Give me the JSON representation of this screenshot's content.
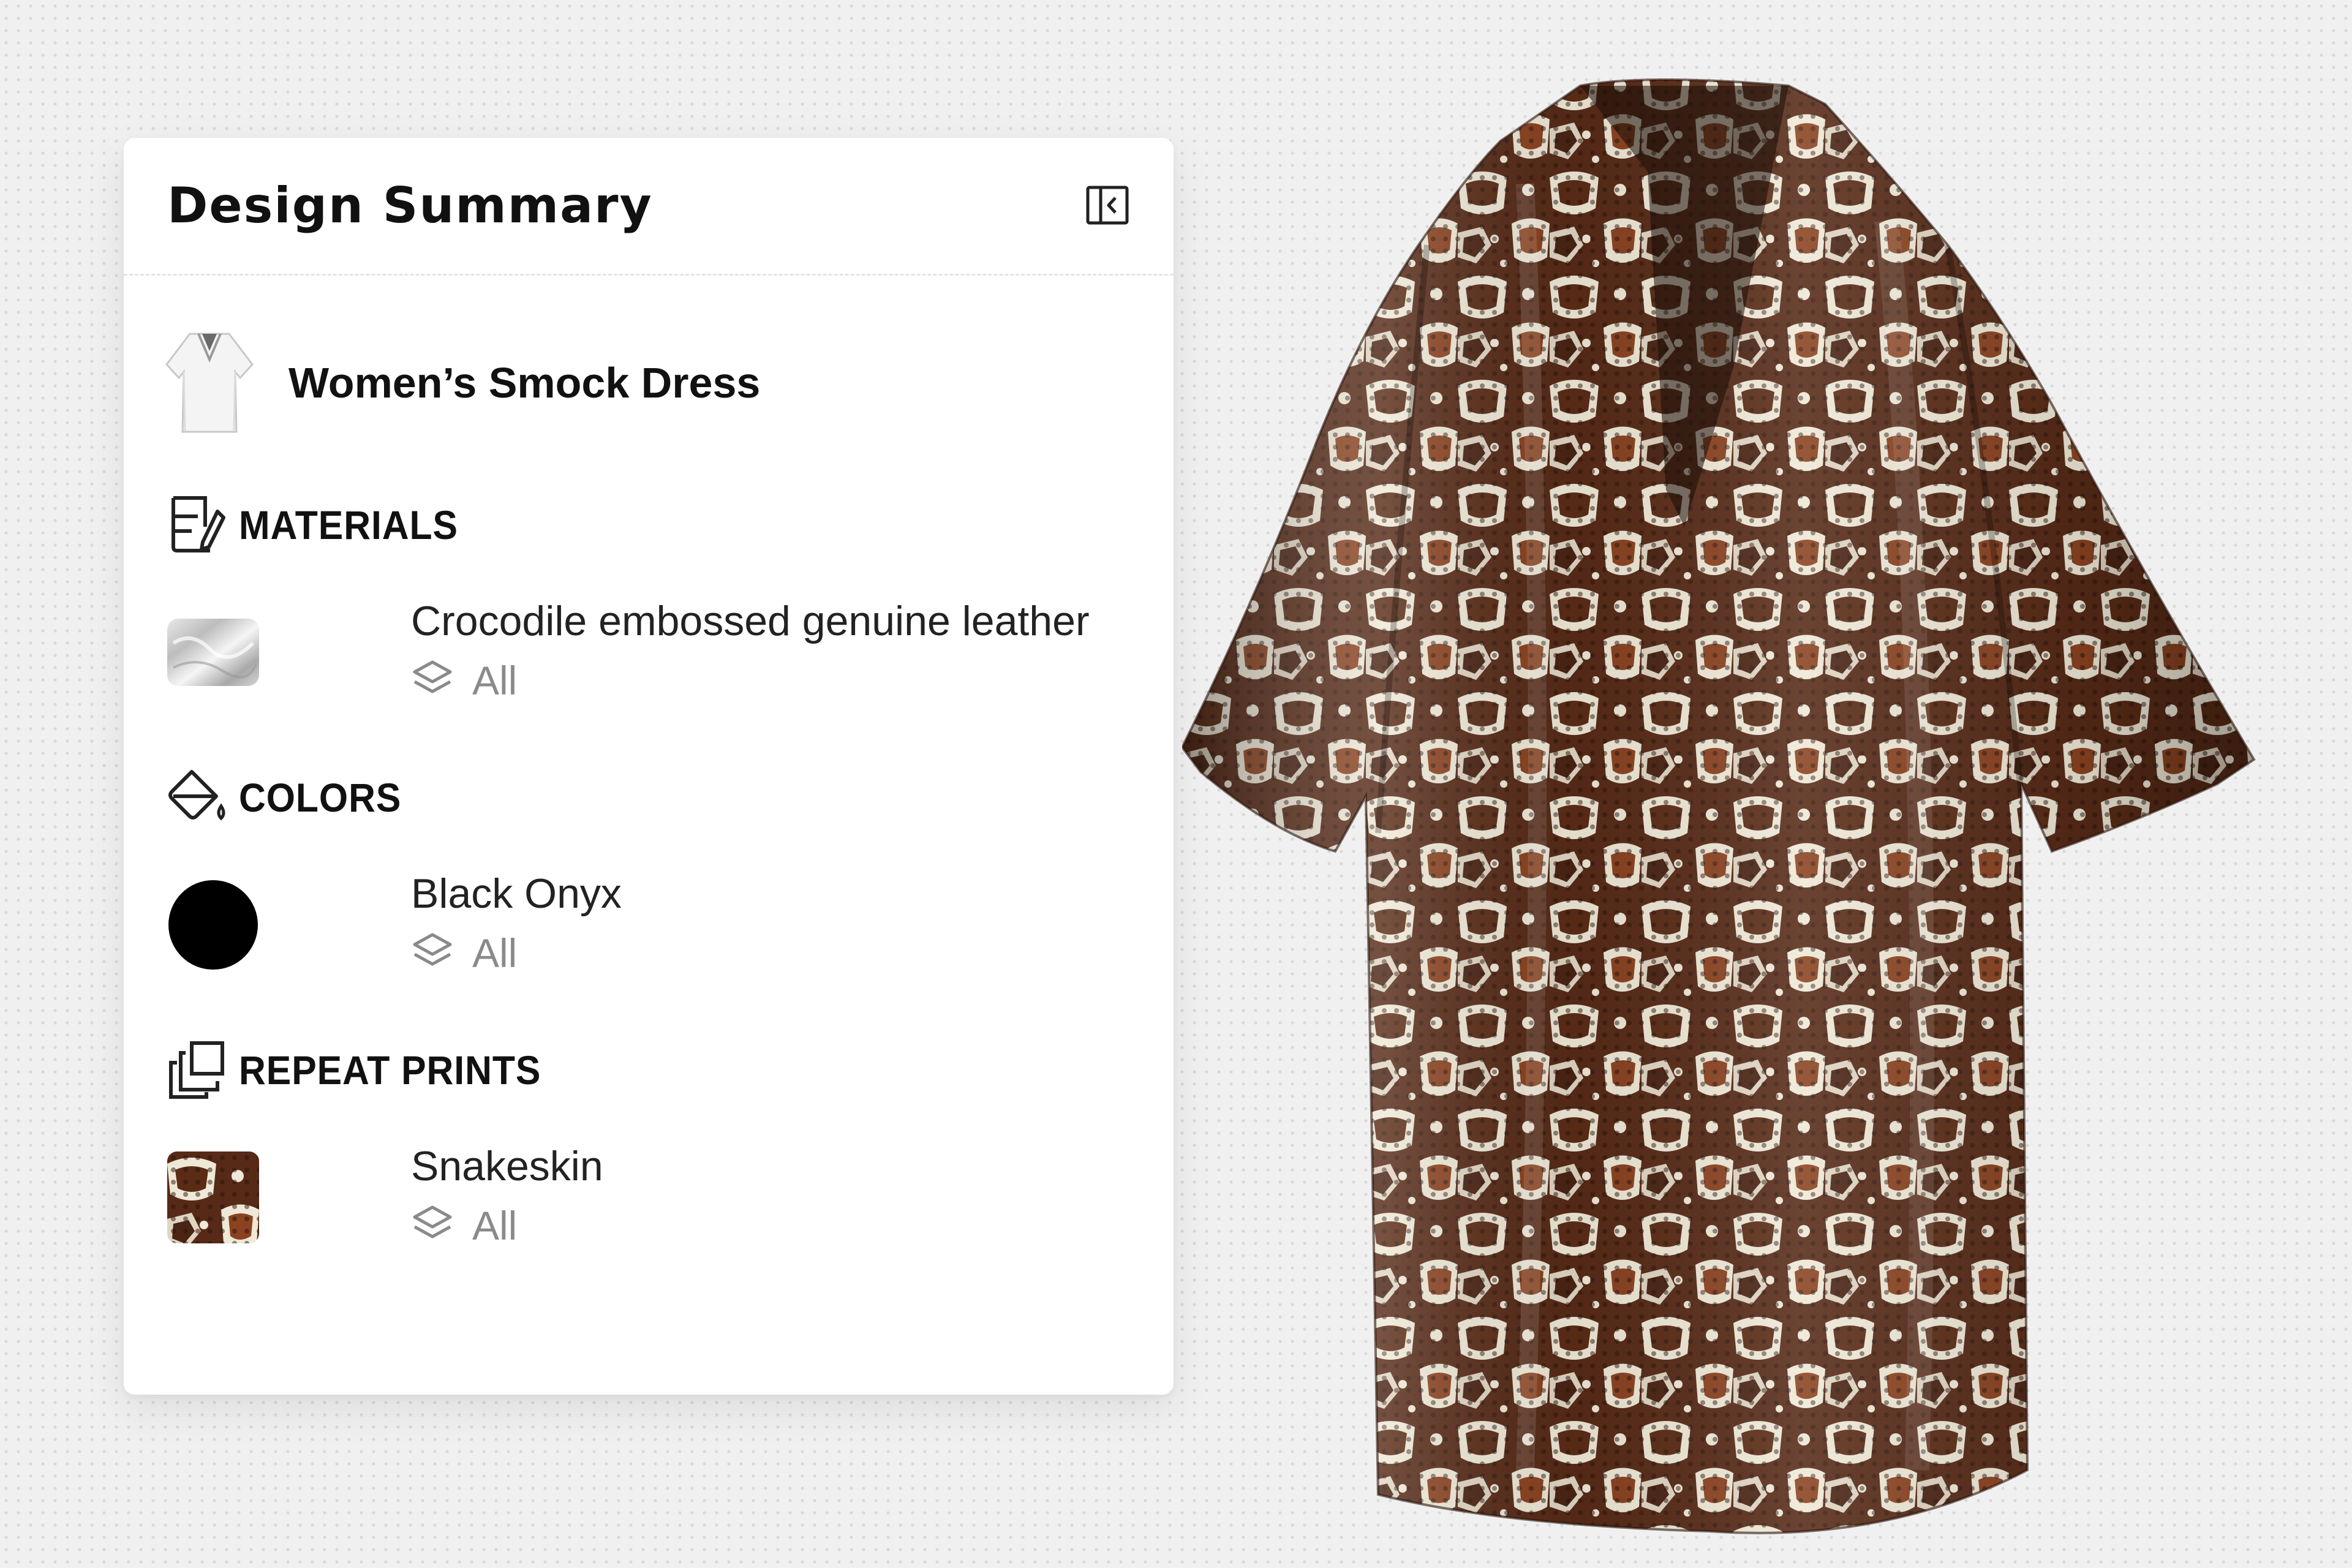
{
  "panel": {
    "title": "Design Summary",
    "collapse_icon": "sidebar-collapse-icon"
  },
  "product": {
    "name": "Women’s Smock Dress",
    "thumb_icon": "dress-thumbnail"
  },
  "sections": {
    "materials": {
      "label": "MATERIALS",
      "icon": "materials-icon",
      "item": {
        "name": "Crocodile embossed genuine leather",
        "scope": "All",
        "swatch": "silver-leather-swatch"
      }
    },
    "colors": {
      "label": "COLORS",
      "icon": "paint-bucket-icon",
      "item": {
        "name": "Black Onyx",
        "scope": "All",
        "swatch_color": "#000000"
      }
    },
    "repeat_prints": {
      "label": "REPEAT PRINTS",
      "icon": "repeat-prints-icon",
      "item": {
        "name": "Snakeskin",
        "scope": "All",
        "swatch": "snakeskin-swatch"
      }
    }
  },
  "colors": {
    "panel_bg": "#ffffff",
    "page_bg": "#f0f0f0",
    "print_dark": "#3a1e12",
    "print_mid": "#7a3a1c",
    "print_light": "#efe8d6"
  }
}
